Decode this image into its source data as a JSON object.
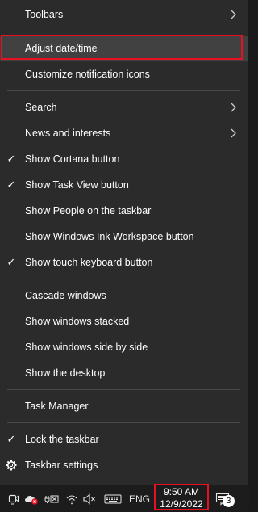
{
  "menu": {
    "toolbars": "Toolbars",
    "adjust_datetime": "Adjust date/time",
    "customize_notifications": "Customize notification icons",
    "search": "Search",
    "news": "News and interests",
    "cortana": "Show Cortana button",
    "task_view": "Show Task View button",
    "people": "Show People on the taskbar",
    "ink": "Show Windows Ink Workspace button",
    "touch_keyboard": "Show touch keyboard button",
    "cascade": "Cascade windows",
    "stacked": "Show windows stacked",
    "side_by_side": "Show windows side by side",
    "desktop": "Show the desktop",
    "task_manager": "Task Manager",
    "lock": "Lock the taskbar",
    "settings": "Taskbar settings",
    "check_glyph": "✓"
  },
  "taskbar": {
    "language": "ENG",
    "time": "9:50 AM",
    "date": "12/9/2022",
    "notification_count": "3"
  },
  "colors": {
    "menu_bg": "#2b2b2b",
    "highlight": "#414141",
    "annotation_red": "#e81123",
    "separator": "#4a4a4a"
  }
}
